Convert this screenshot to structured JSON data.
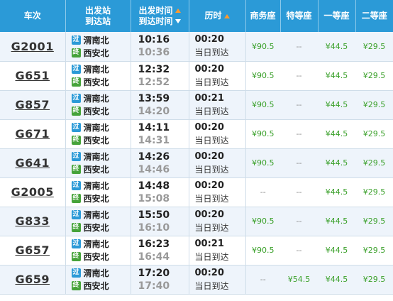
{
  "header": {
    "train": "车次",
    "stations_line1": "出发站",
    "stations_line2": "到达站",
    "times_line1": "出发时间",
    "times_line2": "到达时间",
    "duration": "历时",
    "business": "商务座",
    "premium": "特等座",
    "first": "一等座",
    "second": "二等座"
  },
  "badges": {
    "pass": "过",
    "end": "终"
  },
  "rows": [
    {
      "train": "G2001",
      "from": "渭南北",
      "to": "西安北",
      "dep": "10:16",
      "arr": "10:36",
      "dur": "00:20",
      "day": "当日到达",
      "business": "¥90.5",
      "premium": "--",
      "first": "¥44.5",
      "second": "¥29.5"
    },
    {
      "train": "G651",
      "from": "渭南北",
      "to": "西安北",
      "dep": "12:32",
      "arr": "12:52",
      "dur": "00:20",
      "day": "当日到达",
      "business": "¥90.5",
      "premium": "--",
      "first": "¥44.5",
      "second": "¥29.5"
    },
    {
      "train": "G857",
      "from": "渭南北",
      "to": "西安北",
      "dep": "13:59",
      "arr": "14:20",
      "dur": "00:21",
      "day": "当日到达",
      "business": "¥90.5",
      "premium": "--",
      "first": "¥44.5",
      "second": "¥29.5"
    },
    {
      "train": "G671",
      "from": "渭南北",
      "to": "西安北",
      "dep": "14:11",
      "arr": "14:31",
      "dur": "00:20",
      "day": "当日到达",
      "business": "¥90.5",
      "premium": "--",
      "first": "¥44.5",
      "second": "¥29.5"
    },
    {
      "train": "G641",
      "from": "渭南北",
      "to": "西安北",
      "dep": "14:26",
      "arr": "14:46",
      "dur": "00:20",
      "day": "当日到达",
      "business": "¥90.5",
      "premium": "--",
      "first": "¥44.5",
      "second": "¥29.5"
    },
    {
      "train": "G2005",
      "from": "渭南北",
      "to": "西安北",
      "dep": "14:48",
      "arr": "15:08",
      "dur": "00:20",
      "day": "当日到达",
      "business": "--",
      "premium": "--",
      "first": "¥44.5",
      "second": "¥29.5"
    },
    {
      "train": "G833",
      "from": "渭南北",
      "to": "西安北",
      "dep": "15:50",
      "arr": "16:10",
      "dur": "00:20",
      "day": "当日到达",
      "business": "¥90.5",
      "premium": "--",
      "first": "¥44.5",
      "second": "¥29.5"
    },
    {
      "train": "G657",
      "from": "渭南北",
      "to": "西安北",
      "dep": "16:23",
      "arr": "16:44",
      "dur": "00:21",
      "day": "当日到达",
      "business": "¥90.5",
      "premium": "--",
      "first": "¥44.5",
      "second": "¥29.5"
    },
    {
      "train": "G659",
      "from": "渭南北",
      "to": "西安北",
      "dep": "17:20",
      "arr": "17:40",
      "dur": "00:20",
      "day": "当日到达",
      "business": "--",
      "premium": "¥54.5",
      "first": "¥44.5",
      "second": "¥29.5"
    }
  ]
}
